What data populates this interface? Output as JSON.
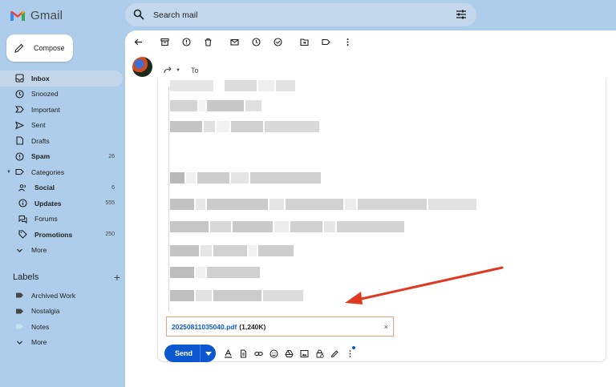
{
  "app": {
    "name": "Gmail"
  },
  "search": {
    "placeholder": "Search mail"
  },
  "compose": {
    "label": "Compose"
  },
  "nav": [
    {
      "label": "Inbox",
      "count": "",
      "icon": "inbox-icon",
      "active": true,
      "bold": true
    },
    {
      "label": "Snoozed",
      "count": "",
      "icon": "clock-icon"
    },
    {
      "label": "Important",
      "count": "",
      "icon": "important-icon"
    },
    {
      "label": "Sent",
      "count": "",
      "icon": "send-icon"
    },
    {
      "label": "Drafts",
      "count": "",
      "icon": "draft-icon"
    },
    {
      "label": "Spam",
      "count": "26",
      "icon": "spam-icon",
      "bold": true
    },
    {
      "label": "Categories",
      "count": "",
      "icon": "label-icon"
    },
    {
      "label": "Social",
      "count": "6",
      "icon": "people-icon",
      "bold": true
    },
    {
      "label": "Updates",
      "count": "555",
      "icon": "info-icon",
      "bold": true
    },
    {
      "label": "Forums",
      "count": "",
      "icon": "forum-icon"
    },
    {
      "label": "Promotions",
      "count": "250",
      "icon": "tag-icon",
      "bold": true
    },
    {
      "label": "More",
      "count": "",
      "icon": "chevron-down-icon"
    }
  ],
  "labels": {
    "heading": "Labels",
    "add": "+",
    "items": [
      {
        "label": "Archived Work",
        "color": "#444746"
      },
      {
        "label": "Nostalgia",
        "color": "#444746"
      },
      {
        "label": "Notes",
        "color": "#a8d2ee"
      },
      {
        "label": "More",
        "color": ""
      }
    ]
  },
  "reply": {
    "to_label": "To"
  },
  "attachment": {
    "filename": "20250811035040.pdf",
    "size": "(1,240K)",
    "close": "×"
  },
  "send": {
    "label": "Send"
  },
  "colors": {
    "accent": "#0b57d0",
    "annotation_arrow": "#e0391f",
    "attachment_border": "#e8a27f"
  }
}
